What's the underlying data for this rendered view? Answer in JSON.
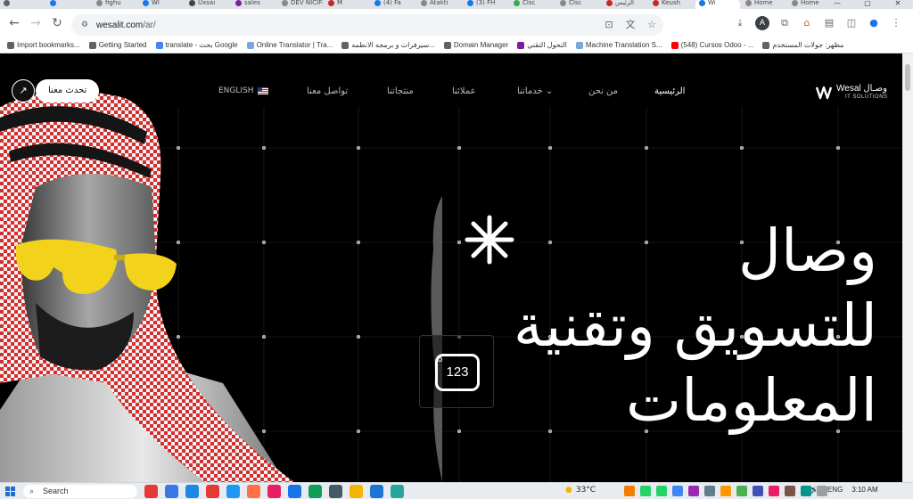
{
  "browser": {
    "tabs": [
      {
        "label": "",
        "color": "#5f6368"
      },
      {
        "label": "",
        "color": "#1877f2"
      },
      {
        "label": "fighu",
        "color": "#888"
      },
      {
        "label": "Wl",
        "color": "#1877f2"
      },
      {
        "label": "Uxsai",
        "color": "#444"
      },
      {
        "label": "sales",
        "color": "#7b1fa2"
      },
      {
        "label": "DEV NICIFI",
        "color": "#888"
      },
      {
        "label": "M",
        "color": "#c62828"
      },
      {
        "label": "(4) Fa",
        "color": "#1877f2"
      },
      {
        "label": "Atakti",
        "color": "#888"
      },
      {
        "label": "(3) FH",
        "color": "#1877f2"
      },
      {
        "label": "Clsc",
        "color": "#34a853"
      },
      {
        "label": "Clsc",
        "color": "#888"
      },
      {
        "label": "الرئيس",
        "color": "#c62828"
      },
      {
        "label": "Keush",
        "color": "#c62828"
      },
      {
        "label": "Wi",
        "color": "#1a73e8"
      },
      {
        "label": "Home",
        "color": "#888"
      },
      {
        "label": "Home",
        "color": "#888"
      }
    ],
    "window_controls": [
      "—",
      "▢",
      "✕"
    ],
    "url_host": "wesalit.com",
    "url_path": "/ar/",
    "bookmarks": [
      {
        "label": "Import bookmarks...",
        "color": "#5f6368"
      },
      {
        "label": "Getting Started",
        "color": "#5f6368"
      },
      {
        "label": "translate - بحث Google",
        "color": "#4285f4"
      },
      {
        "label": "Online Translator | Tra...",
        "color": "#7aa7d8"
      },
      {
        "label": "سيرفرات و برمجه الانظمه...",
        "color": "#5f6368"
      },
      {
        "label": "Domain Manager",
        "color": "#5f6368"
      },
      {
        "label": "التحول التقني",
        "color": "#7b1fa2"
      },
      {
        "label": "Machine Translation S...",
        "color": "#7aa7d8"
      },
      {
        "label": "(548) Cursos Odoo - ...",
        "color": "#ff0000"
      },
      {
        "label": "مظهر: جولات المستخدم",
        "color": "#5f6368"
      }
    ]
  },
  "site": {
    "cta_label": "تحدث معنا",
    "cta_arrow": "↗",
    "language": "ENGLISH",
    "nav": [
      {
        "label": "تواصل معنا"
      },
      {
        "label": "منتجاتنا"
      },
      {
        "label": "عملائنا"
      },
      {
        "label": "خدماتنا ⌄"
      },
      {
        "label": "من نحن"
      },
      {
        "label": "الرئيسية"
      }
    ],
    "logo_text": "Wesal وصـال",
    "logo_sub": "IT SOLUTIONS",
    "headline": [
      "وصال",
      "للتسويق وتقنية",
      "المعلومات"
    ],
    "counter_value": "123"
  },
  "taskbar": {
    "search_placeholder": "Search",
    "weather": "33°C",
    "language": "ENG",
    "time": "3:10 AM",
    "apps": [
      "#e53935",
      "#3b78e7",
      "#1e88e5",
      "#e53935",
      "#2196f3",
      "#ff7043",
      "#e91e63",
      "#1a73e8",
      "#0f9d58",
      "#455a64",
      "#f4b400",
      "#1976d2",
      "#26a69a",
      "#f57c00",
      "#25d366",
      "#25d366",
      "#4285f4",
      "#9c27b0"
    ]
  }
}
